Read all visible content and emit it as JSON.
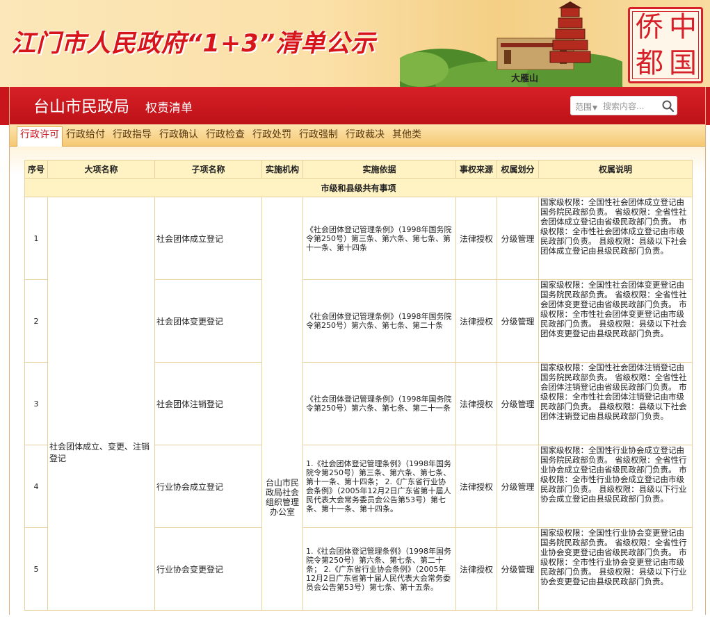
{
  "banner": {
    "title": "江门市人民政府“1+3”清单公示",
    "mountain_label": "大雁山",
    "seal_chars": [
      "中",
      "国",
      "侨",
      "都"
    ]
  },
  "header": {
    "dept_name": "台山市民政局",
    "dept_sub": "权责清单",
    "search": {
      "scope": "范围",
      "placeholder": "搜索内容..."
    }
  },
  "tabs": [
    {
      "label": "行政许可",
      "active": true
    },
    {
      "label": "行政给付"
    },
    {
      "label": "行政指导"
    },
    {
      "label": "行政确认"
    },
    {
      "label": "行政检查"
    },
    {
      "label": "行政处罚"
    },
    {
      "label": "行政强制"
    },
    {
      "label": "行政裁决"
    },
    {
      "label": "其他类"
    }
  ],
  "table": {
    "headers": [
      "序号",
      "大项名称",
      "子项名称",
      "实施机构",
      "实施依据",
      "事权来源",
      "权属划分",
      "权属说明"
    ],
    "group_label": "市级和县级共有事项",
    "major_item": "社会团体成立、变更、注销登记",
    "agency": "台山市民政局社会组织管理办公室",
    "rows": [
      {
        "no": "1",
        "sub": "社会团体成立登记",
        "basis": "《社会团体登记管理条例》（1998年国务院令第250号）第三条、第六条、第七条、第十一条、第十四条",
        "source": "法律授权",
        "division": "分级管理",
        "desc": "国家级权限：全国性社会团体成立登记由国务院民政部负责。 省级权限：全省性社会团体成立登记由省级民政部门负责。 市级权限：全市性社会团体成立登记由市级民政部门负责。 县级权限：县级以下社会团体成立登记由县级民政部门负责。"
      },
      {
        "no": "2",
        "sub": "社会团体变更登记",
        "basis": "《社会团体登记管理条例》（1998年国务院令第250号）第六条、第七条、第二十条",
        "source": "法律授权",
        "division": "分级管理",
        "desc": "国家级权限：全国性社会团体变更登记由国务院民政部负责。 省级权限：全省性社会团体变更登记由省级民政部门负责。 市级权限：全市性社会团体变更登记由市级民政部门负责。 县级权限：县级以下社会团体变更登记由县级民政部门负责。"
      },
      {
        "no": "3",
        "sub": "社会团体注销登记",
        "basis": "《社会团体登记管理条例》（1998年国务院令第250号）第六条、第七条、第二十一条",
        "source": "法律授权",
        "division": "分级管理",
        "desc": "国家级权限：全国性社会团体注销登记由国务院民政部负责。 省级权限：全省性社会团体注销登记由省级民政部门负责。 市级权限：全市性社会团体注销登记由市级民政部门负责。 县级权限：县级以下社会团体注销登记由县级民政部门负责。"
      },
      {
        "no": "4",
        "sub": "行业协会成立登记",
        "basis": "1.《社会团体登记管理条例》（1998年国务院令第250号）第三条、第六条、第七条、第十一条、第十四条； 2.《广东省行业协会条例》（2005年12月2日广东省第十届人民代表大会常务委员会公告第53号）第七条、第十一条、第十四条。",
        "source": "法律授权",
        "division": "分级管理",
        "desc": "国家级权限：全国性行业协会成立登记由国务院民政部负责。 省级权限：全省性行业协会成立登记由省级民政部门负责。 市级权限：全市性行业协会成立登记由市级民政部门负责。 县级权限：县级以下行业协会成立登记由县级民政部门负责。"
      },
      {
        "no": "5",
        "sub": "行业协会变更登记",
        "basis": "1.《社会团体登记管理条例》（1998年国务院令第250号）第六条、第七条、第二十条； 2.《广东省行业协会条例》（2005年12月2日广东省第十届人民代表大会常务委员会公告第53号）第七条、第十五条。",
        "source": "法律授权",
        "division": "分级管理",
        "desc": "国家级权限：全国性行业协会变更登记由国务院民政部负责。 省级权限：全省性行业协会变更登记由省级民政部门负责。 市级权限：全市性行业协会变更登记由市级民政部门负责。 县级权限：县级以下行业协会变更登记由县级民政部门负责。"
      }
    ]
  },
  "colors": {
    "brand_red": "#c9161d",
    "title_red": "#d8141b",
    "tab_bg": "#f5c873",
    "table_border": "#e7d19a"
  }
}
